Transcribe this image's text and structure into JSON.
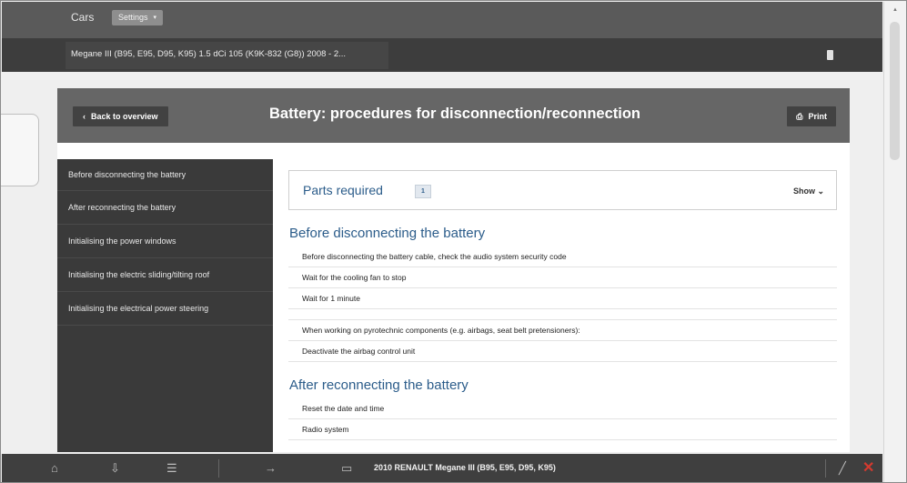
{
  "top_nav": {
    "cars_tab": "Cars",
    "settings_label": "Settings",
    "settings_caret": "▾"
  },
  "vehicle_bar": {
    "title": "Megane III (B95, E95, D95, K95) 1.5 dCi 105 (K9K-832 (G8)) 2008 - 2..."
  },
  "card": {
    "back_label": "Back to overview",
    "back_icon": "‹",
    "title": "Battery: procedures for disconnection/reconnection",
    "print_label": "Print",
    "print_icon": "⎙"
  },
  "sidebar": {
    "items": [
      {
        "label": "Before disconnecting the battery"
      },
      {
        "label": "After reconnecting the battery"
      },
      {
        "label": "Initialising the power windows"
      },
      {
        "label": "Initialising the electric sliding/tilting roof"
      },
      {
        "label": "Initialising the electrical power steering"
      }
    ]
  },
  "parts": {
    "label": "Parts required",
    "count": "1",
    "show_label": "Show ⌄"
  },
  "sections": [
    {
      "heading": "Before disconnecting the battery",
      "steps": [
        "Before disconnecting the battery cable, check the audio system security code",
        "Wait for the cooling fan to stop",
        "Wait for 1 minute",
        "",
        "When working on pyrotechnic components (e.g. airbags, seat belt pretensioners):",
        "Deactivate the airbag control unit"
      ]
    },
    {
      "heading": "After reconnecting the battery",
      "steps": [
        "Reset the date and time",
        "Radio system"
      ]
    }
  ],
  "bottom_bar": {
    "vehicle_label": "2010 RENAULT Megane III (B95, E95, D95, K95)"
  },
  "colors": {
    "accent_blue": "#2b5c8a",
    "dark_bar": "#3d3d3d",
    "header_grey": "#666666",
    "alert_red": "#d43a2f"
  }
}
